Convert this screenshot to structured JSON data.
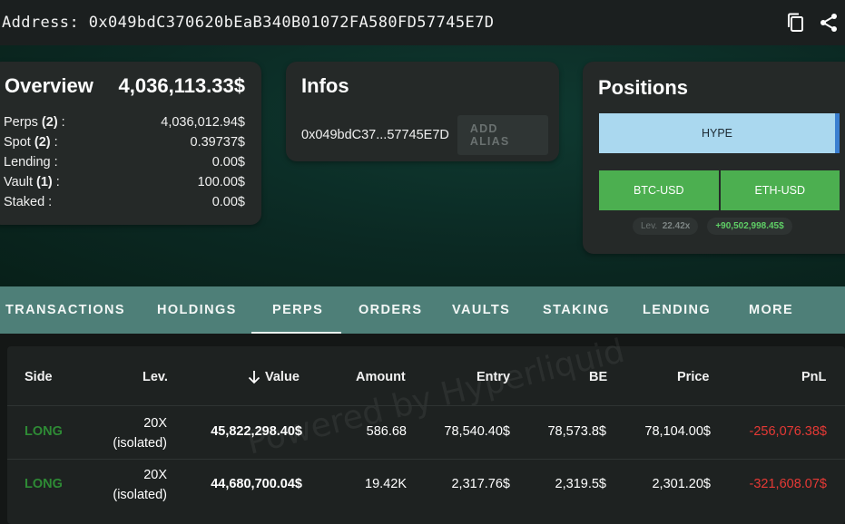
{
  "header": {
    "address_label": "Address: 0x049bdC370620bEaB340B01072FA580FD57745E7D",
    "icons": [
      "copy-icon",
      "share-icon"
    ]
  },
  "overview": {
    "title": "Overview",
    "total": "4,036,113.33$",
    "rows": [
      {
        "label": "Perps",
        "count": "(2)",
        "suffix": " :",
        "value": "4,036,012.94$"
      },
      {
        "label": "Spot",
        "count": "(2)",
        "suffix": " :",
        "value": "0.39737$"
      },
      {
        "label": "Lending :",
        "count": "",
        "suffix": "",
        "value": "0.00$"
      },
      {
        "label": "Vault",
        "count": "(1)",
        "suffix": " :",
        "value": "100.00$"
      },
      {
        "label": "Staked :",
        "count": "",
        "suffix": "",
        "value": "0.00$"
      }
    ]
  },
  "infos": {
    "title": "Infos",
    "short_address": "0x049bdC37...57745E7D",
    "add_alias": "ADD ALIAS"
  },
  "positions": {
    "title": "Positions",
    "hype": "HYPE",
    "pairs": [
      "BTC-USD",
      "ETH-USD"
    ],
    "lev_label": "Lev.",
    "lev_value": "22.42x",
    "pnl": "+90,502,998.45$"
  },
  "tabs": [
    "TRANSACTIONS",
    "HOLDINGS",
    "PERPS",
    "ORDERS",
    "VAULTS",
    "STAKING",
    "LENDING",
    "MORE"
  ],
  "active_tab": "PERPS",
  "table": {
    "headers": {
      "side": "Side",
      "lev": "Lev.",
      "value": "Value",
      "amount": "Amount",
      "entry": "Entry",
      "be": "BE",
      "price": "Price",
      "pnl": "PnL"
    },
    "rows": [
      {
        "side": "LONG",
        "lev": "20X",
        "mode": "(isolated)",
        "value": "45,822,298.40$",
        "amount": "586.68",
        "entry": "78,540.40$",
        "be": "78,573.8$",
        "price": "78,104.00$",
        "pnl": "-256,076.38$"
      },
      {
        "side": "LONG",
        "lev": "20X",
        "mode": "(isolated)",
        "value": "44,680,700.04$",
        "amount": "19.42K",
        "entry": "2,317.76$",
        "be": "2,319.5$",
        "price": "2,301.20$",
        "pnl": "-321,608.07$"
      }
    ]
  },
  "watermark": "Powered by Hyperliquid",
  "colors": {
    "long": "#2e8b35",
    "negative": "#e53935",
    "tab_bar": "#4e7f78",
    "pair_green": "#4caf50",
    "hype_blue": "#aad8ef"
  }
}
